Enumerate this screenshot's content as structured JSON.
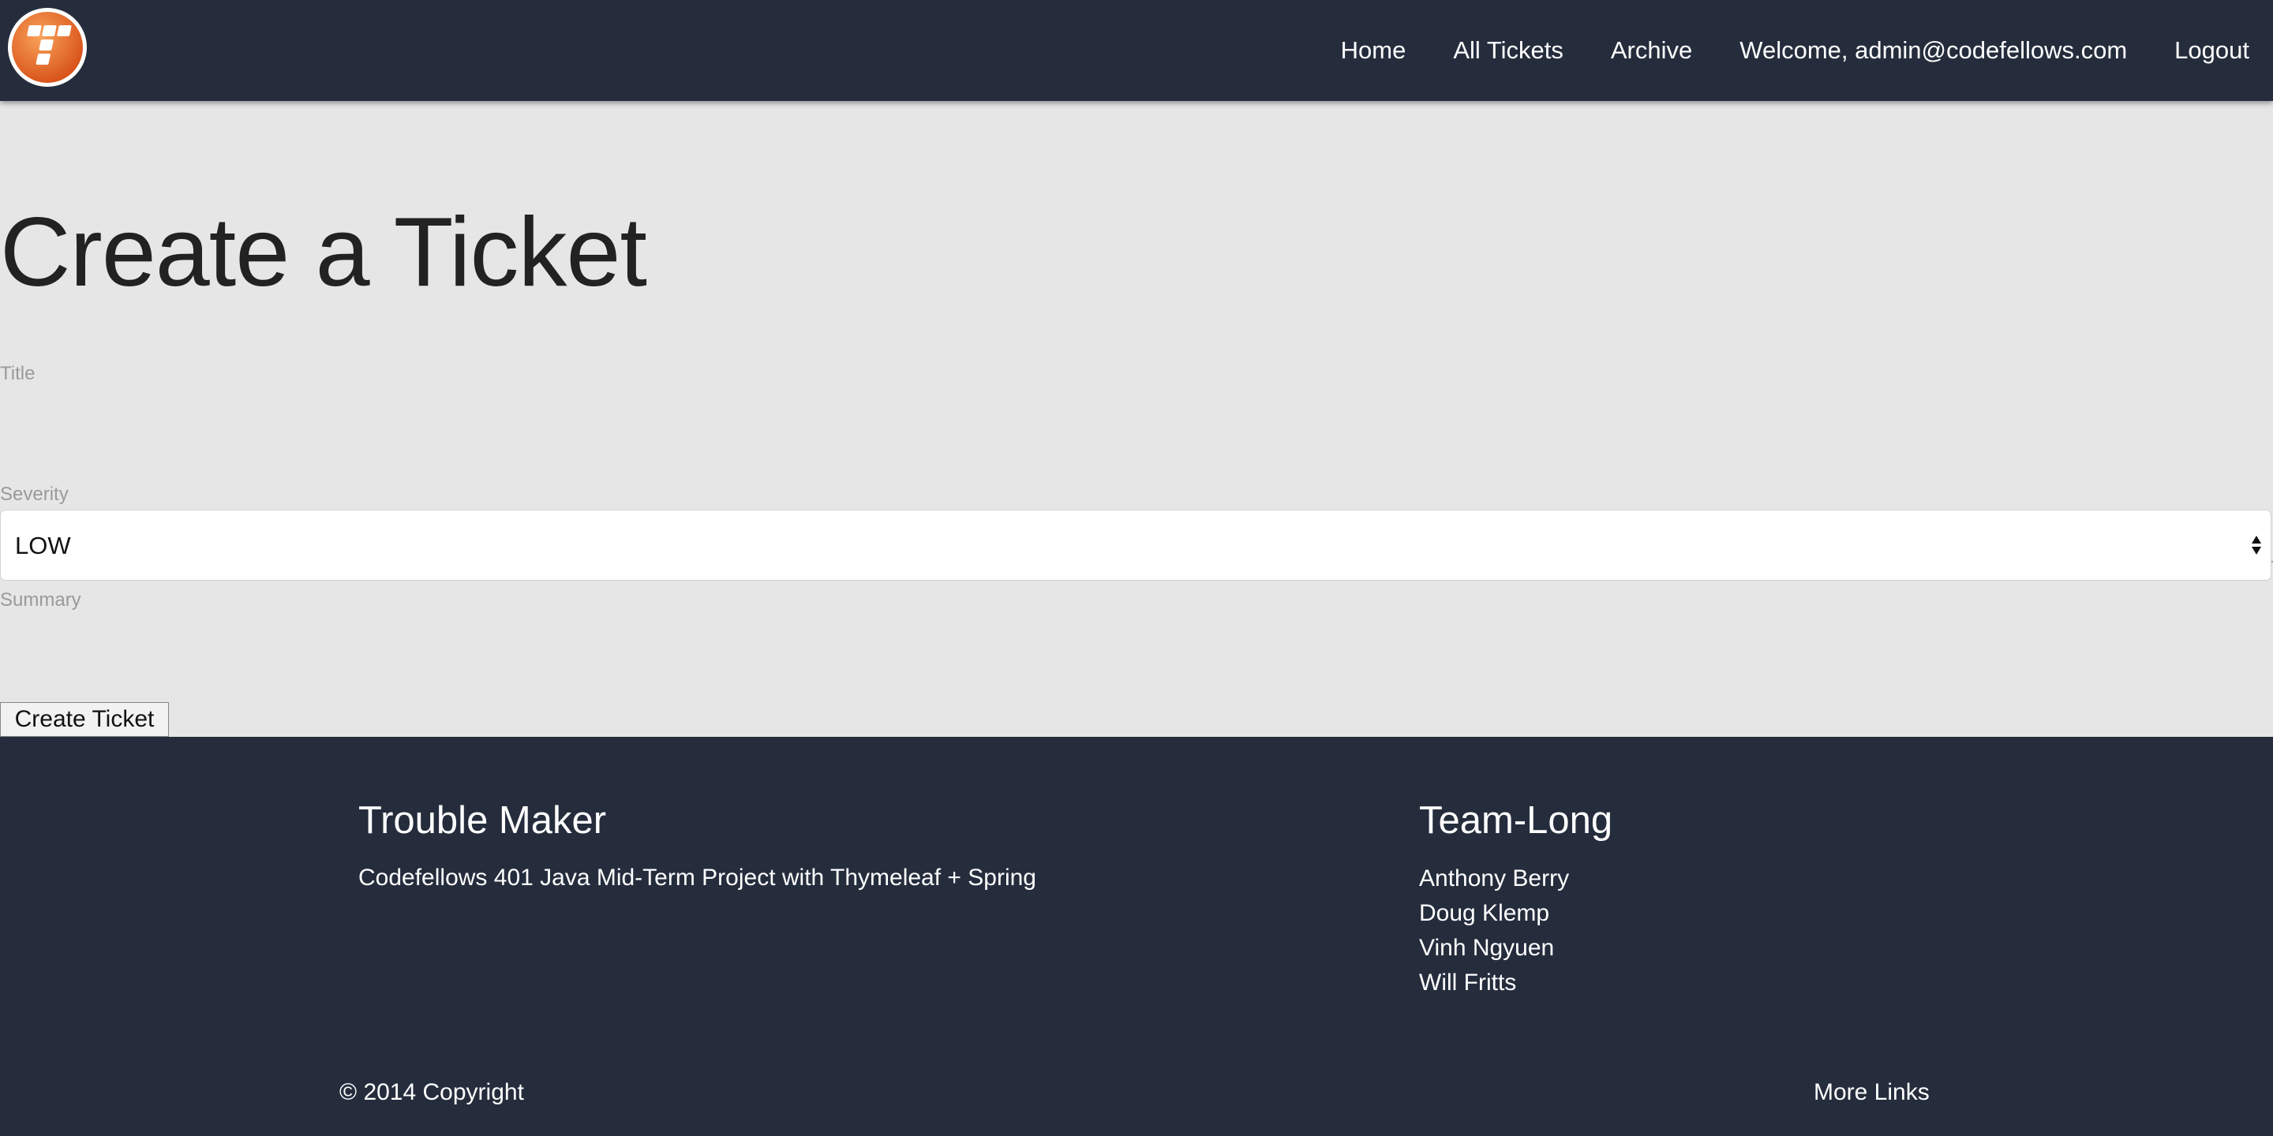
{
  "navbar": {
    "logo_alt": "Trouble Maker logo",
    "links": [
      "Home",
      "All Tickets",
      "Archive",
      "Welcome, admin@codefellows.com",
      "Logout"
    ],
    "background": "#252d3d"
  },
  "main": {
    "title": "Create a Ticket",
    "form": {
      "title_label": "Title",
      "title_value": "",
      "severity_label": "Severity",
      "severity_value": "LOW",
      "summary_label": "Summary",
      "summary_value": "",
      "submit_label": "Create Ticket"
    },
    "background": "#e6e6e6"
  },
  "footer": {
    "brand_title": "Trouble Maker",
    "brand_description": "Codefellows 401 Java Mid-Term Project with Thymeleaf + Spring",
    "team_title": "Team-Long",
    "team_members": [
      "Anthony Berry",
      "Doug Klemp",
      "Vinh Ngyuen",
      "Will Fritts"
    ],
    "copyright": "© 2014 Copyright",
    "more_links": "More Links"
  },
  "icons": {
    "logo": "orange-circle-t-logo",
    "select_arrows": "up-down-arrows-icon"
  }
}
